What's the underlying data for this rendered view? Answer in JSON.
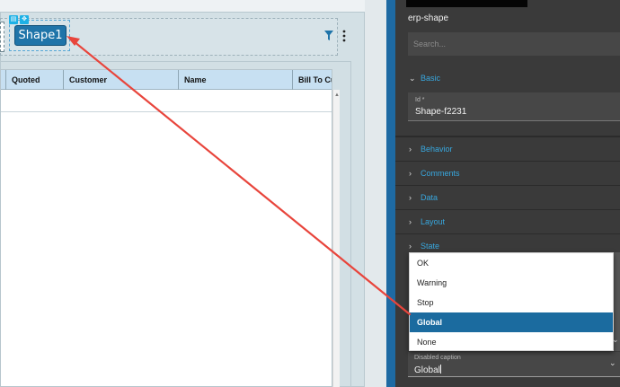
{
  "designer": {
    "shape_label": "Shape1",
    "grid_columns": [
      "Quoted",
      "Customer",
      "Name",
      "Bill To Cu"
    ]
  },
  "panel": {
    "title": "erp-shape",
    "search_placeholder": "Search...",
    "sections": {
      "basic": "Basic",
      "behavior": "Behavior",
      "comments": "Comments",
      "data": "Data",
      "layout": "Layout",
      "state": "State"
    },
    "id_field": {
      "label": "Id *",
      "value": "Shape-f2231"
    }
  },
  "dropdown": {
    "options": [
      "OK",
      "Warning",
      "Stop",
      "Global",
      "None"
    ],
    "selected": "Global"
  },
  "caption_field": {
    "label": "Disabled caption",
    "value": "Global"
  },
  "colors": {
    "accent_blue": "#1b6b9f",
    "section_label": "#38a7de",
    "panel_bg": "#3a3a3a",
    "annotation_arrow": "#e8453c"
  }
}
